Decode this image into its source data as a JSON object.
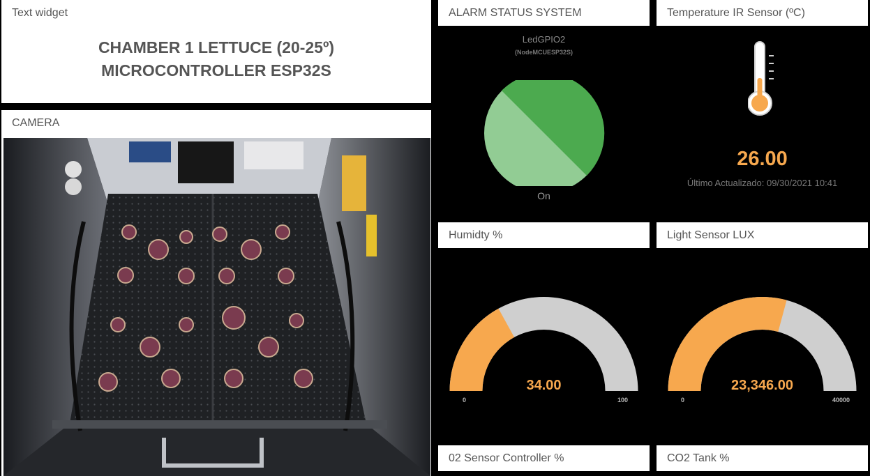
{
  "text_widget": {
    "title": "Text widget",
    "line1": "CHAMBER 1 LETTUCE (20-25º)",
    "line2": "MICROCONTROLLER ESP32S"
  },
  "camera": {
    "title": "CAMERA",
    "image_icon": "plant-growth-chamber-photo"
  },
  "alarm": {
    "title": "ALARM STATUS SYSTEM",
    "led_name": "LedGPIO2",
    "device": "(NodeMCUESP32S)",
    "state": "On",
    "colors": {
      "on": "#4caa4f",
      "off": "#92cc94"
    }
  },
  "temperature": {
    "title": "Temperature IR Sensor (ºC)",
    "value": "26.00",
    "updated": "Último Actualizado: 09/30/2021 10:41",
    "icon": "thermometer-icon",
    "color": "#f7a84e"
  },
  "humidity": {
    "title": "Humidty %",
    "value_text": "34.00",
    "value": 34,
    "min": "0",
    "max": "100",
    "min_value": 0,
    "max_value": 100
  },
  "light": {
    "title": "Light Sensor LUX",
    "value_text": "23,346.00",
    "value": 23346,
    "min": "0",
    "max": "40000",
    "min_value": 0,
    "max_value": 40000
  },
  "o2": {
    "title": "02 Sensor Controller %"
  },
  "co2": {
    "title": "CO2 Tank %"
  },
  "colors": {
    "gauge_fill": "#f7a84e",
    "gauge_track": "#cfcfcf",
    "value": "#f7a84e"
  }
}
